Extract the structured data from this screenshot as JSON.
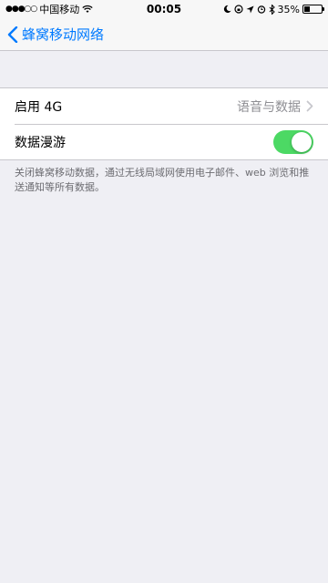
{
  "status": {
    "carrier": "中国移动",
    "time": "00:05",
    "battery": "35%",
    "battery_level": 0.35
  },
  "nav": {
    "back_label": "蜂窝移动网络"
  },
  "settings": {
    "rows": [
      {
        "label": "启用 4G",
        "value": "语音与数据"
      },
      {
        "label": "数据漫游",
        "toggle_on": true
      }
    ],
    "footer": "关闭蜂窝移动数据，通过无线局域网使用电子邮件、web 浏览和推送通知等所有数据。"
  },
  "colors": {
    "accent": "#007aff",
    "toggle_on": "#4cd964"
  }
}
